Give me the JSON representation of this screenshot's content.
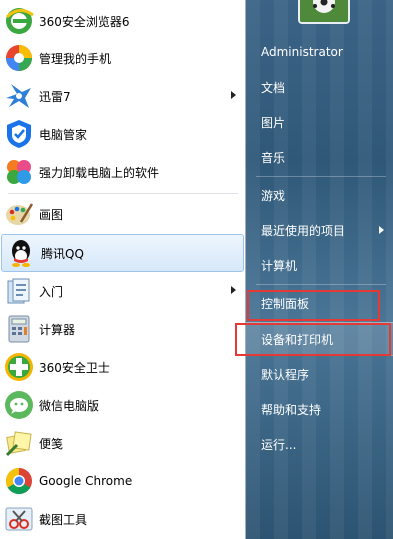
{
  "left_items": [
    {
      "label": "360安全浏览器6",
      "icon": "browser-360-icon"
    },
    {
      "label": "管理我的手机",
      "icon": "phone-manager-icon"
    },
    {
      "label": "迅雷7",
      "icon": "xunlei-icon",
      "submenu": true
    },
    {
      "label": "电脑管家",
      "icon": "pc-manager-icon"
    },
    {
      "label": "强力卸载电脑上的软件",
      "icon": "uninstaller-icon"
    },
    {
      "label": "画图",
      "icon": "paint-icon"
    },
    {
      "label": "腾讯QQ",
      "icon": "qq-icon",
      "highlighted": true
    },
    {
      "label": "入门",
      "icon": "getting-started-icon",
      "submenu": true
    },
    {
      "label": "计算器",
      "icon": "calculator-icon"
    },
    {
      "label": "360安全卫士",
      "icon": "safe-360-icon"
    },
    {
      "label": "微信电脑版",
      "icon": "wechat-icon"
    },
    {
      "label": "便笺",
      "icon": "sticky-notes-icon"
    },
    {
      "label": "Google Chrome",
      "icon": "chrome-icon"
    },
    {
      "label": "截图工具",
      "icon": "snipping-tool-icon"
    }
  ],
  "right_items": [
    {
      "label": "Administrator"
    },
    {
      "label": "文档"
    },
    {
      "label": "图片"
    },
    {
      "label": "音乐"
    },
    {
      "label": "游戏"
    },
    {
      "label": "最近使用的项目",
      "submenu": true
    },
    {
      "label": "计算机"
    },
    {
      "label": "控制面板",
      "annotated": true
    },
    {
      "label": "设备和打印机",
      "highlighted": true,
      "annotated": true
    },
    {
      "label": "默认程序"
    },
    {
      "label": "帮助和支持"
    },
    {
      "label": "运行..."
    }
  ],
  "colors": {
    "annotation": "#e53935",
    "hover": "#d6e8fa"
  }
}
